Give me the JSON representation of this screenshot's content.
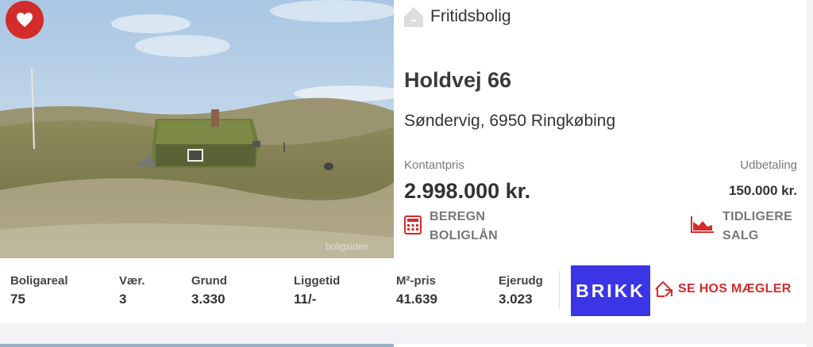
{
  "listing": {
    "favorite": true,
    "image_watermark": "boligsiden",
    "property_type": "Fritidsbolig",
    "address": "Holdvej 66",
    "city": "Søndervig, 6950 Ringkøbing",
    "cash_price_label": "Kontantpris",
    "cash_price": "2.998.000 kr.",
    "down_payment_label": "Udbetaling",
    "down_payment": "150.000 kr.",
    "calc_loan_line1": "BEREGN",
    "calc_loan_line2": "BOLIGLÅN",
    "prev_sales_line1": "TIDLIGERE",
    "prev_sales_line2": "SALG"
  },
  "stats": [
    {
      "label": "Boligareal",
      "value": "75"
    },
    {
      "label": "Vær.",
      "value": "3"
    },
    {
      "label": "Grund",
      "value": "3.330"
    },
    {
      "label": "Liggetid",
      "value": "11/-"
    },
    {
      "label": "M²-pris",
      "value": "41.639"
    },
    {
      "label": "Ejerudg",
      "value": "3.023"
    }
  ],
  "agent": {
    "brand_logo_text": "BRIKK",
    "cta": "SE HOS MÆGLER"
  },
  "colors": {
    "accent": "#d42b2b",
    "brand": "#3c35e5"
  },
  "icons": [
    "heart-icon",
    "house-icon",
    "calculator-icon",
    "chart-icon",
    "house-link-icon"
  ]
}
